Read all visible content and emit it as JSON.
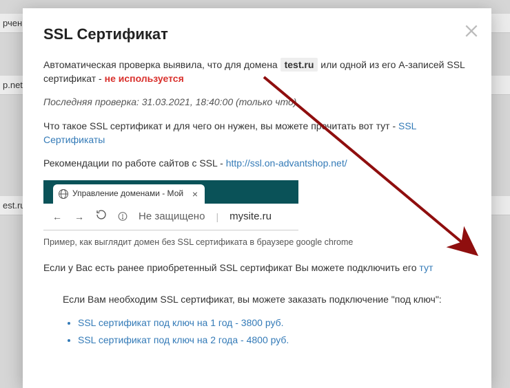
{
  "bg": {
    "row1": "рчен",
    "row2": "p.net",
    "row3": "est.ru"
  },
  "modal": {
    "title": "SSL Сертификат",
    "intro_before": "Автоматическая проверка выявила, что для домена ",
    "domain": "test.ru",
    "intro_after": " или одной из его А-записей SSL сертификат - ",
    "not_used": "не используется",
    "last_check": "Последняя проверка: 31.03.2021, 18:40:00 (только что)",
    "what_is_before": "Что такое SSL сертификат и для чего он нужен, вы можете прочитать вот тут - ",
    "what_is_link": "SSL Сертификаты",
    "recs_before": "Рекомендации по работе сайтов с SSL - ",
    "recs_link": "http://ssl.on-advantshop.net/",
    "browser_tab_title": "Управление доменами - Мой м",
    "browser_insecure": "Не защищено",
    "browser_url": "mysite.ru",
    "caption": "Пример, как выглядит домен без SSL сертификата в браузере google chrome",
    "existing_before": "Если у Вас есть ранее приобретенный SSL сертификат Вы можете подключить его ",
    "existing_link": "тут",
    "need_cert": "Если Вам необходим SSL сертификат, вы можете заказать подключение \"под ключ\":",
    "offers": [
      "SSL сертификат под ключ на 1 год - 3800 руб.",
      "SSL сертификат под ключ на 2 года - 4800 руб."
    ]
  }
}
